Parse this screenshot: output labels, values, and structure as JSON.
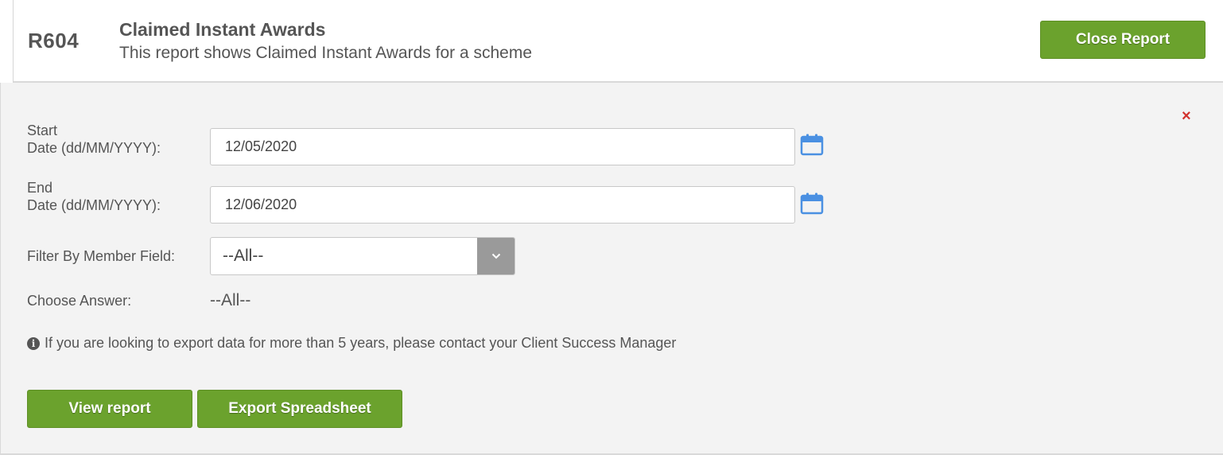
{
  "header": {
    "code": "R604",
    "title": "Claimed Instant Awards",
    "subtitle": "This report shows Claimed Instant Awards for a scheme",
    "close_label": "Close Report"
  },
  "form": {
    "start_label_line1": "Start",
    "start_label_line2": "Date (dd/MM/YYYY):",
    "start_value": "12/05/2020",
    "end_label_line1": "End",
    "end_label_line2": "Date (dd/MM/YYYY):",
    "end_value": "12/06/2020",
    "filter_label": "Filter By Member Field:",
    "filter_value": "--All--",
    "answer_label": "Choose Answer:",
    "answer_value": "--All--",
    "info_text": "If you are looking to export data for more than 5 years, please contact your Client Success Manager",
    "dismiss_symbol": "×"
  },
  "actions": {
    "view_label": "View report",
    "export_label": "Export Spreadsheet"
  },
  "colors": {
    "accent_green": "#6ba22d",
    "calendar_blue": "#4a90e2",
    "dismiss_red": "#d2322d"
  },
  "icons": {
    "calendar": "calendar-icon",
    "info": "info-icon",
    "chevron": "chevron-down-icon",
    "close": "close-icon"
  }
}
